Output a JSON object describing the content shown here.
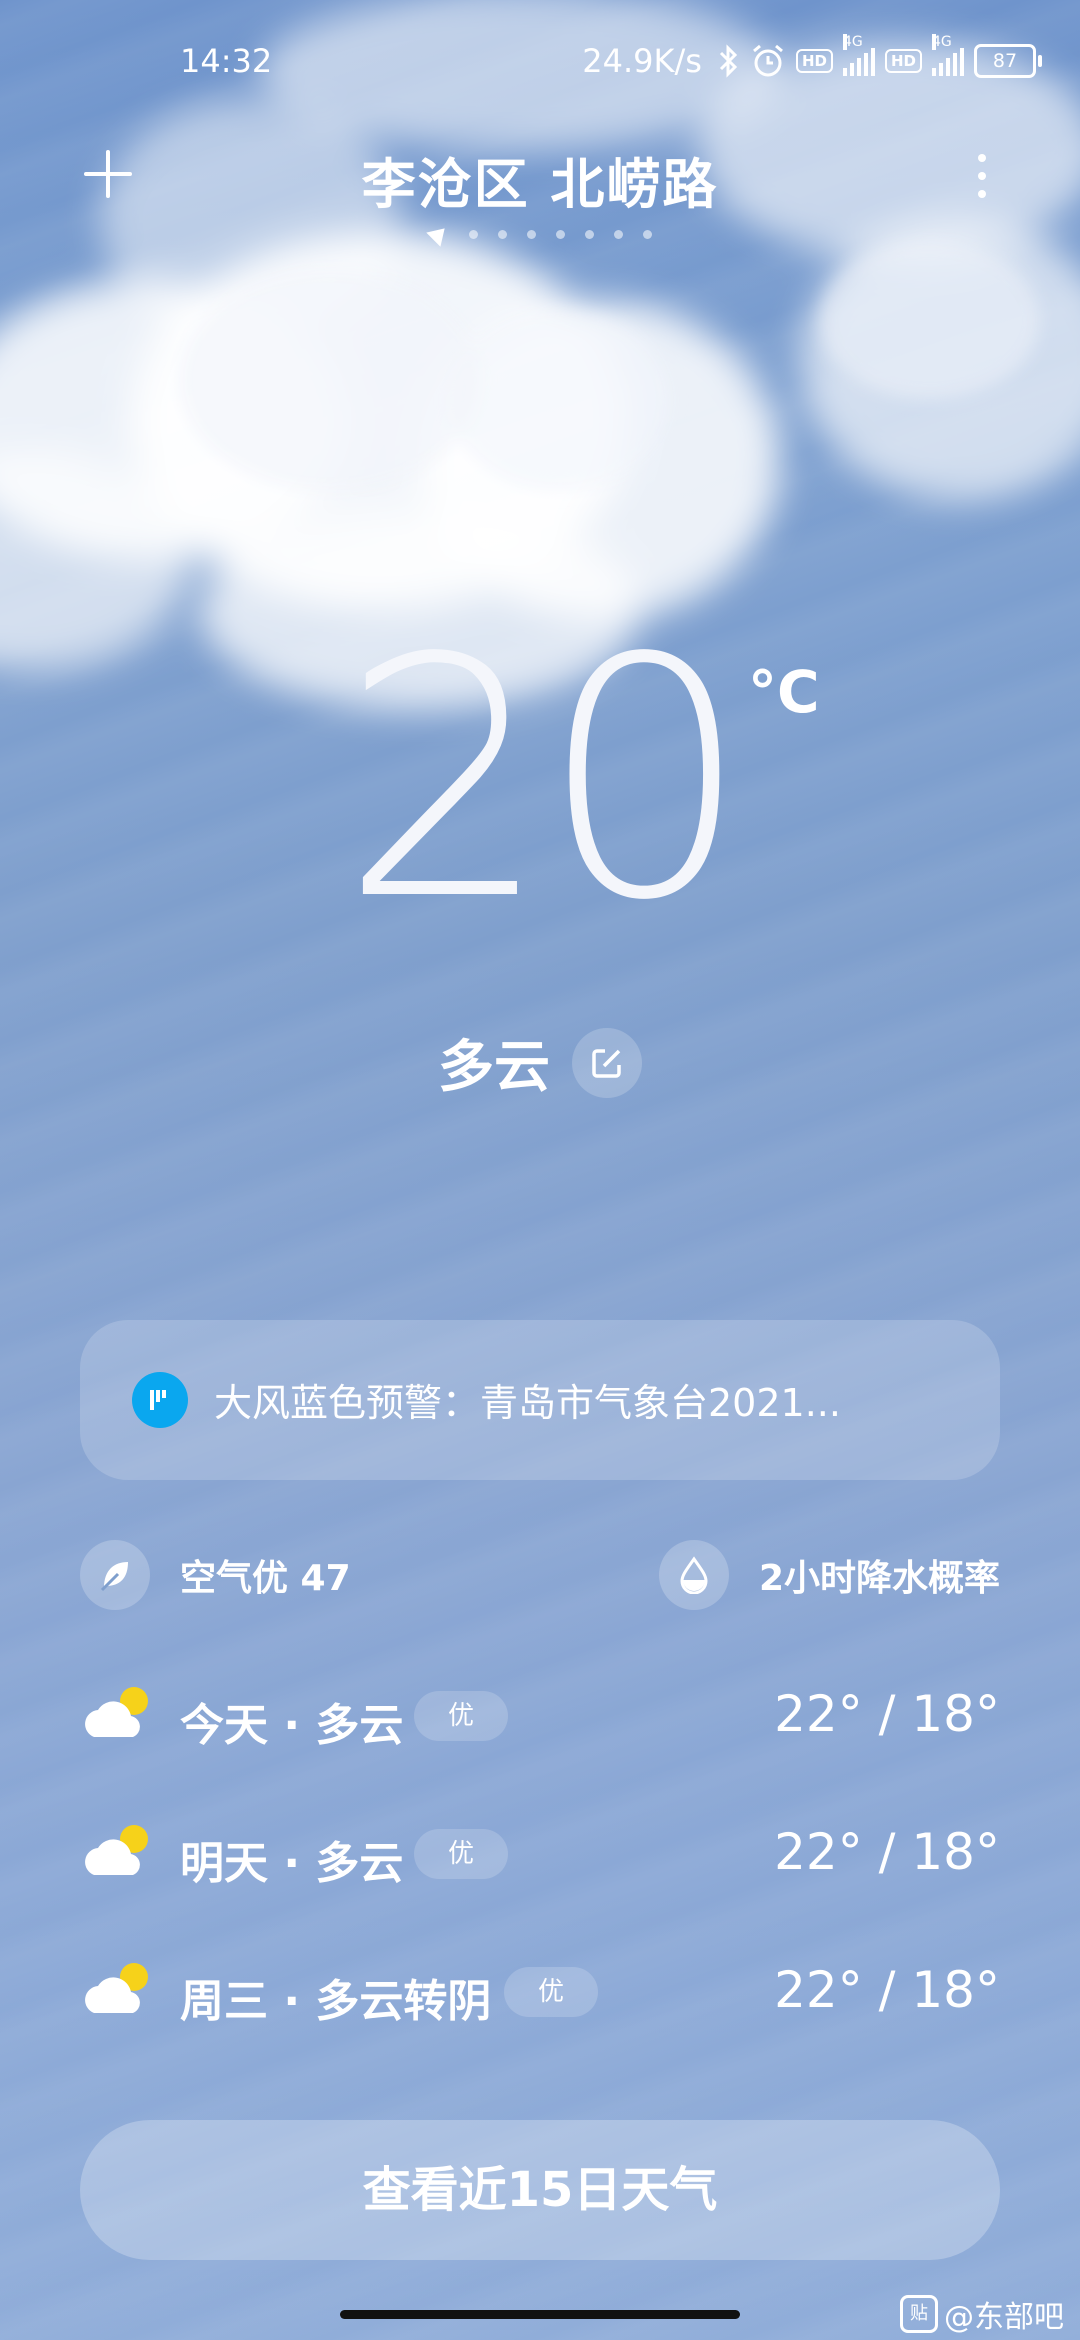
{
  "status_bar": {
    "time": "14:32",
    "net_speed": "24.9K/s",
    "hd_label": "HD",
    "net_type": "4G",
    "battery": "87"
  },
  "header": {
    "location": "李沧区 北崂路",
    "page_count": 8
  },
  "current": {
    "temperature": "20",
    "unit": "°C",
    "condition": "多云"
  },
  "alert": {
    "text": "大风蓝色预警：青岛市气象台2021..."
  },
  "info": {
    "air_quality": "空气优 47",
    "rain_prob": "2小时降水概率"
  },
  "forecast": [
    {
      "label": "今天 · 多云",
      "badge": "优",
      "temps": "22° / 18°"
    },
    {
      "label": "明天 · 多云",
      "badge": "优",
      "temps": "22° / 18°"
    },
    {
      "label": "周三 · 多云转阴",
      "badge": "优",
      "temps": "22° / 18°"
    }
  ],
  "button": {
    "label": "查看近15日天气"
  },
  "watermark": {
    "logo": "贴",
    "text": "@东部吧"
  },
  "colors": {
    "alert_icon": "#0aa7ef",
    "sun": "#f6d21a"
  }
}
